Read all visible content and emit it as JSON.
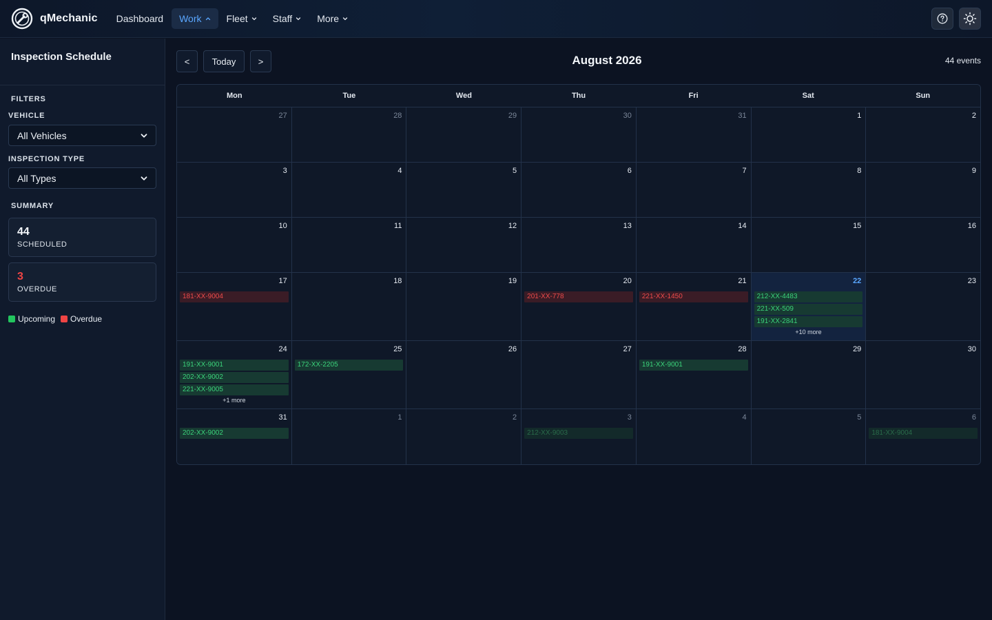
{
  "app": {
    "brand": "qMechanic",
    "nav": [
      {
        "label": "Dashboard",
        "chevron": "",
        "active": false
      },
      {
        "label": "Work",
        "chevron": "up",
        "active": true
      },
      {
        "label": "Fleet",
        "chevron": "down",
        "active": false
      },
      {
        "label": "Staff",
        "chevron": "down",
        "active": false
      },
      {
        "label": "More",
        "chevron": "down",
        "active": false
      }
    ],
    "icons": [
      "help-icon",
      "sun-icon"
    ],
    "colors": {
      "accent": "#5aa7ff",
      "upcoming": "#22c55e",
      "overdue": "#ef4444",
      "background": "#0c1322"
    }
  },
  "sidebar": {
    "title": "Inspection Schedule",
    "filters_label": "FILTERS",
    "vehicle_label": "VEHICLE",
    "vehicle_value": "All Vehicles",
    "type_label": "INSPECTION TYPE",
    "type_value": "All Types",
    "summary_label": "SUMMARY",
    "scheduled_count": "44",
    "scheduled_label": "SCHEDULED",
    "overdue_count": "3",
    "overdue_label": "OVERDUE",
    "legend_upcoming": "Upcoming",
    "legend_overdue": "Overdue"
  },
  "calendar": {
    "prev_label": "<",
    "today_label": "Today",
    "next_label": ">",
    "month_title": "August 2026",
    "event_count": "44 events",
    "days_of_week": [
      "Mon",
      "Tue",
      "Wed",
      "Thu",
      "Fri",
      "Sat",
      "Sun"
    ],
    "weeks": [
      [
        {
          "day": "27",
          "other": true,
          "events": []
        },
        {
          "day": "28",
          "other": true,
          "events": []
        },
        {
          "day": "29",
          "other": true,
          "events": []
        },
        {
          "day": "30",
          "other": true,
          "events": []
        },
        {
          "day": "31",
          "other": true,
          "events": []
        },
        {
          "day": "1",
          "events": []
        },
        {
          "day": "2",
          "events": []
        }
      ],
      [
        {
          "day": "3",
          "events": []
        },
        {
          "day": "4",
          "events": []
        },
        {
          "day": "5",
          "events": []
        },
        {
          "day": "6",
          "events": []
        },
        {
          "day": "7",
          "events": []
        },
        {
          "day": "8",
          "events": []
        },
        {
          "day": "9",
          "events": []
        }
      ],
      [
        {
          "day": "10",
          "events": []
        },
        {
          "day": "11",
          "events": []
        },
        {
          "day": "12",
          "events": []
        },
        {
          "day": "13",
          "events": []
        },
        {
          "day": "14",
          "events": []
        },
        {
          "day": "15",
          "events": []
        },
        {
          "day": "16",
          "events": []
        }
      ],
      [
        {
          "day": "17",
          "events": [
            {
              "label": "181-XX-9004",
              "status": "overdue"
            }
          ]
        },
        {
          "day": "18",
          "events": []
        },
        {
          "day": "19",
          "events": []
        },
        {
          "day": "20",
          "events": [
            {
              "label": "201-XX-778",
              "status": "overdue"
            }
          ]
        },
        {
          "day": "21",
          "events": [
            {
              "label": "221-XX-1450",
              "status": "overdue"
            }
          ]
        },
        {
          "day": "22",
          "today": true,
          "events": [
            {
              "label": "212-XX-4483",
              "status": "upcoming"
            },
            {
              "label": "221-XX-509",
              "status": "upcoming"
            },
            {
              "label": "191-XX-2841",
              "status": "upcoming"
            }
          ],
          "more": "+10 more"
        },
        {
          "day": "23",
          "events": []
        }
      ],
      [
        {
          "day": "24",
          "events": [
            {
              "label": "191-XX-9001",
              "status": "upcoming"
            },
            {
              "label": "202-XX-9002",
              "status": "upcoming"
            },
            {
              "label": "221-XX-9005",
              "status": "upcoming"
            }
          ],
          "more": "+1 more"
        },
        {
          "day": "25",
          "events": [
            {
              "label": "172-XX-2205",
              "status": "upcoming"
            }
          ]
        },
        {
          "day": "26",
          "events": []
        },
        {
          "day": "27",
          "events": []
        },
        {
          "day": "28",
          "events": [
            {
              "label": "191-XX-9001",
              "status": "upcoming"
            }
          ]
        },
        {
          "day": "29",
          "events": []
        },
        {
          "day": "30",
          "events": []
        }
      ],
      [
        {
          "day": "31",
          "events": [
            {
              "label": "202-XX-9002",
              "status": "upcoming"
            }
          ]
        },
        {
          "day": "1",
          "other": true,
          "events": []
        },
        {
          "day": "2",
          "other": true,
          "events": []
        },
        {
          "day": "3",
          "other": true,
          "events": [
            {
              "label": "212-XX-9003",
              "status": "upcoming"
            }
          ]
        },
        {
          "day": "4",
          "other": true,
          "events": []
        },
        {
          "day": "5",
          "other": true,
          "events": []
        },
        {
          "day": "6",
          "other": true,
          "events": [
            {
              "label": "181-XX-9004",
              "status": "upcoming"
            }
          ]
        }
      ]
    ]
  }
}
